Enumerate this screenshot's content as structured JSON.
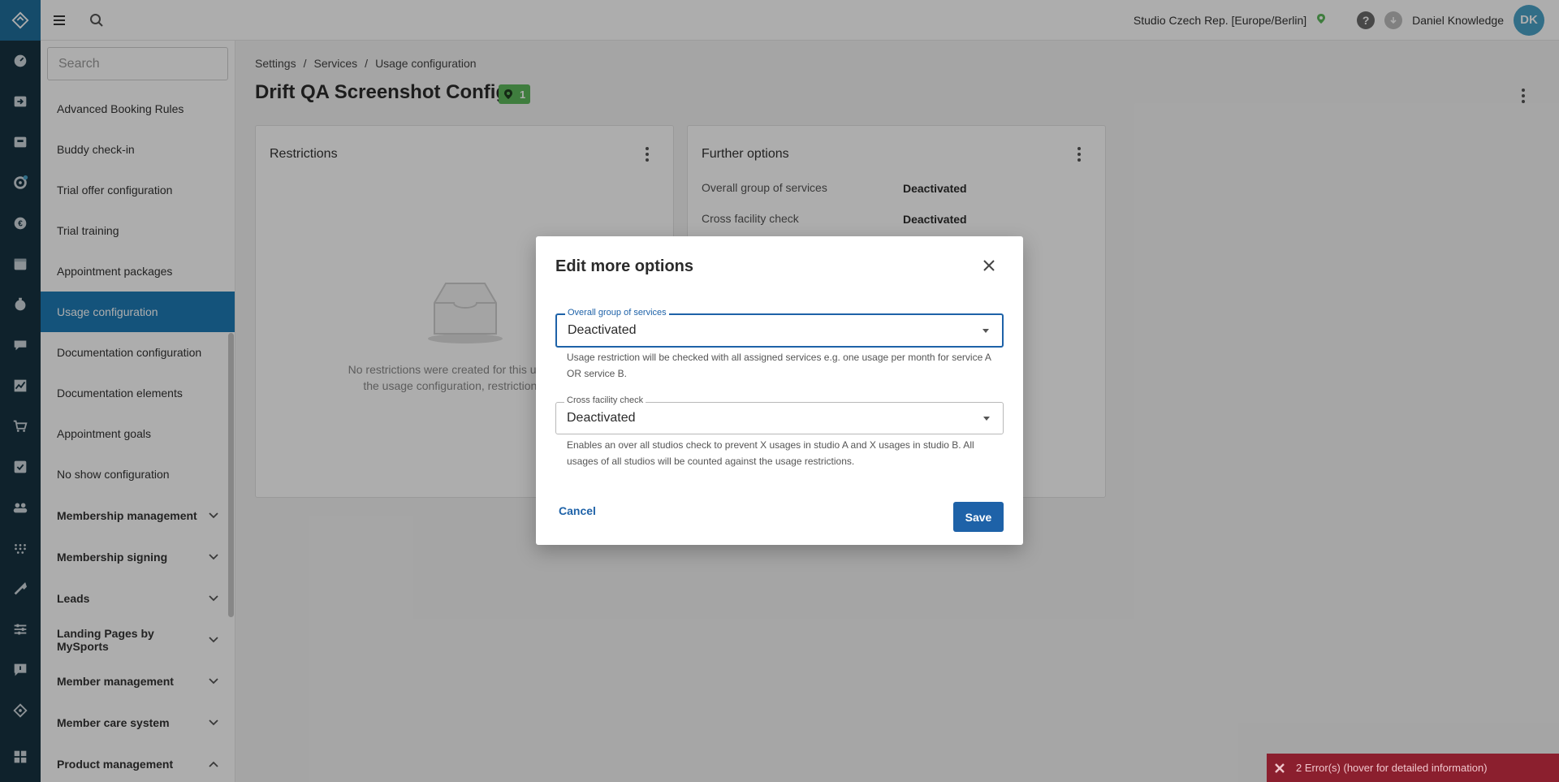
{
  "topbar": {
    "studio": "Studio Czech Rep. [Europe/Berlin]",
    "user_name": "Daniel Knowledge",
    "avatar_initials": "DK"
  },
  "sidebar": {
    "search_placeholder": "Search",
    "items": [
      {
        "label": "Advanced Booking Rules"
      },
      {
        "label": "Buddy check-in"
      },
      {
        "label": "Trial offer configuration"
      },
      {
        "label": "Trial training"
      },
      {
        "label": "Appointment packages"
      },
      {
        "label": "Usage configuration",
        "active": true
      },
      {
        "label": "Documentation configuration"
      },
      {
        "label": "Documentation elements"
      },
      {
        "label": "Appointment goals"
      },
      {
        "label": "No show configuration"
      }
    ],
    "groups": [
      {
        "label": "Membership management",
        "expanded": false
      },
      {
        "label": "Membership signing",
        "expanded": false
      },
      {
        "label": "Leads",
        "expanded": false
      },
      {
        "label": "Landing Pages by MySports",
        "expanded": false
      },
      {
        "label": "Member management",
        "expanded": false
      },
      {
        "label": "Member care system",
        "expanded": false
      },
      {
        "label": "Product management",
        "expanded": true
      }
    ]
  },
  "breadcrumb": [
    "Settings",
    "Services",
    "Usage configuration"
  ],
  "page": {
    "title": "Drift QA Screenshot Config",
    "location_badge_count": "1"
  },
  "restrictions_card": {
    "title": "Restrictions",
    "empty_text_line1": "No restrictions were created for this usage con",
    "empty_text_line2": "the usage configuration, restrictions mus"
  },
  "options_card": {
    "title": "Further options",
    "rows": [
      {
        "label": "Overall group of services",
        "value": "Deactivated"
      },
      {
        "label": "Cross facility check",
        "value": "Deactivated"
      }
    ]
  },
  "dialog": {
    "title": "Edit more options",
    "fields": [
      {
        "label": "Overall group of services",
        "value": "Deactivated",
        "helper": "Usage restriction will be checked with all assigned services e.g. one usage per month for service A OR service B."
      },
      {
        "label": "Cross facility check",
        "value": "Deactivated",
        "helper": "Enables an over all studios check to prevent X usages in studio A and X usages in studio B. All usages of all studios will be counted against the usage restrictions."
      }
    ],
    "cancel_label": "Cancel",
    "save_label": "Save"
  },
  "toast": {
    "text": "2 Error(s) (hover for detailed information)"
  },
  "colors": {
    "rail": "#173342",
    "accent": "#1e62a8",
    "active_item": "#1e7bb5",
    "badge": "#5db85c",
    "error": "#8b1f2e"
  }
}
